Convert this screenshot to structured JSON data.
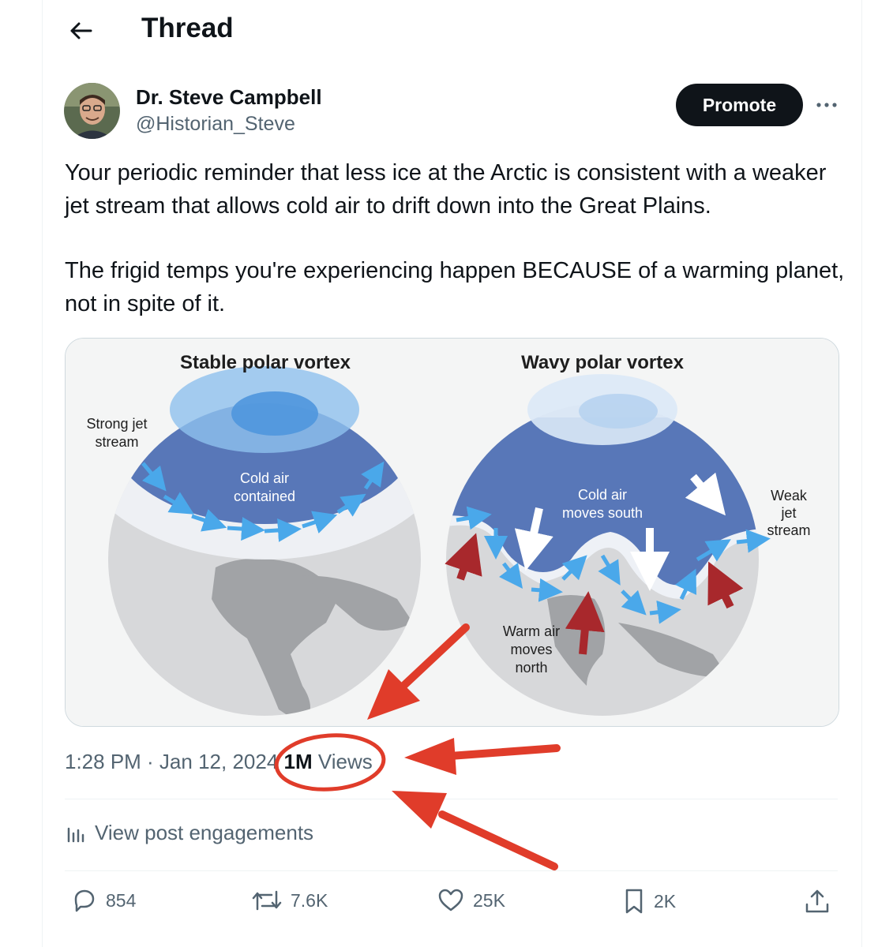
{
  "header": {
    "title": "Thread"
  },
  "author": {
    "name": "Dr. Steve Campbell",
    "handle": "@Historian_Steve"
  },
  "promote_label": "Promote",
  "tweet": {
    "paragraphs": [
      "Your periodic reminder that less ice at the Arctic is consistent with a weaker jet stream that allows cold air to drift down into the Great Plains.",
      "The frigid temps you're experiencing happen BECAUSE of a warming planet, not in spite of it."
    ]
  },
  "media": {
    "left_title": "Stable polar vortex",
    "right_title": "Wavy polar vortex",
    "strong_jet_1": "Strong jet",
    "strong_jet_2": "stream",
    "cold_contained_1": "Cold air",
    "cold_contained_2": "contained",
    "cold_south_1": "Cold air",
    "cold_south_2": "moves south",
    "weak_jet_1": "Weak",
    "weak_jet_2": "jet",
    "weak_jet_3": "stream",
    "warm_1": "Warm air",
    "warm_2": "moves",
    "warm_3": "north"
  },
  "meta": {
    "time": "1:28 PM · Jan 12, 2024",
    "views_count": "1M",
    "views_label": "Views"
  },
  "engagements_label": "View post engagements",
  "actions": {
    "replies": "854",
    "reposts": "7.6K",
    "likes": "25K",
    "bookmarks": "2K"
  },
  "colors": {
    "text": "#0f1419",
    "muted": "#536471",
    "annotation_red": "#e03c2a",
    "ocean_blue": "#5877b8",
    "jet_arrow": "#4aa8ea"
  }
}
